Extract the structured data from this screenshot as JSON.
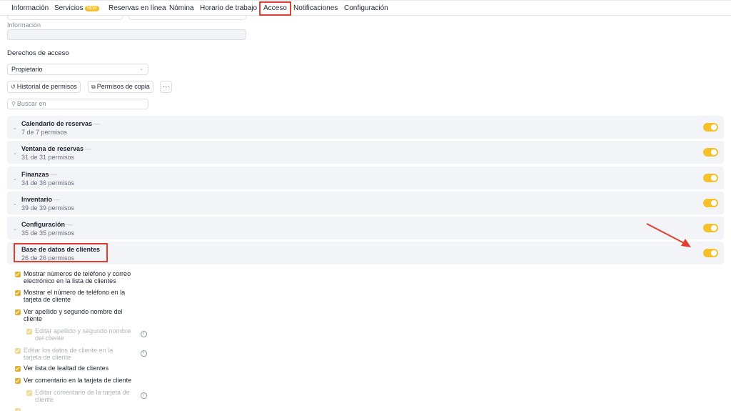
{
  "tabs": [
    {
      "label": "Información"
    },
    {
      "label": "Servicios",
      "badge": "NEW"
    },
    {
      "label": "Reservas en línea"
    },
    {
      "label": "Nómina"
    },
    {
      "label": "Horario de trabajo"
    },
    {
      "label": "Acceso"
    },
    {
      "label": "Notificaciones"
    },
    {
      "label": "Configuración"
    }
  ],
  "info": {
    "label": "Información",
    "value": ""
  },
  "access": {
    "title": "Derechos de acceso",
    "role": "Propietario",
    "history_button": "Historial de permisos",
    "copy_button": "Permisos de copia",
    "more_button": "···",
    "search_placeholder": "Buscar en"
  },
  "groups": [
    {
      "name": "Calendario de reservas",
      "count": "7 de 7 permisos"
    },
    {
      "name": "Ventana de reservas",
      "count": "31 de 31 permisos"
    },
    {
      "name": "Finanzas",
      "count": "34 de 36 permisos"
    },
    {
      "name": "Inventario",
      "count": "39 de 39 permisos"
    },
    {
      "name": "Configuración",
      "count": "35 de 35 permisos"
    },
    {
      "name": "Base de datos de clientes",
      "count": "26 de 26 permisos"
    }
  ],
  "permissions": [
    {
      "line1": "Mostrar números de teléfono y correo",
      "line2": "electrónico en la lista de clientes"
    },
    {
      "line1": "Mostrar el número de teléfono en la",
      "line2": "tarjeta de cliente"
    },
    {
      "line1": "Ver apellido y segundo nombre del",
      "line2": "cliente"
    },
    {
      "line1": "Editar apellido y segundo nombre",
      "line2": "del cliente"
    },
    {
      "line1": "Editar los datos de cliente en la",
      "line2": "tarjeta de cliente"
    },
    {
      "line1": "Ver lista de lealtad de clientes",
      "line2": ""
    },
    {
      "line1": "Ver comentario en la tarjeta de cliente",
      "line2": ""
    },
    {
      "line1": "Editar comentario de la tarjeta de",
      "line2": "cliente"
    }
  ],
  "colors": {
    "accent": "#f5c02a",
    "highlight": "#e03f2f",
    "group_bg": "#f3f4f7"
  }
}
